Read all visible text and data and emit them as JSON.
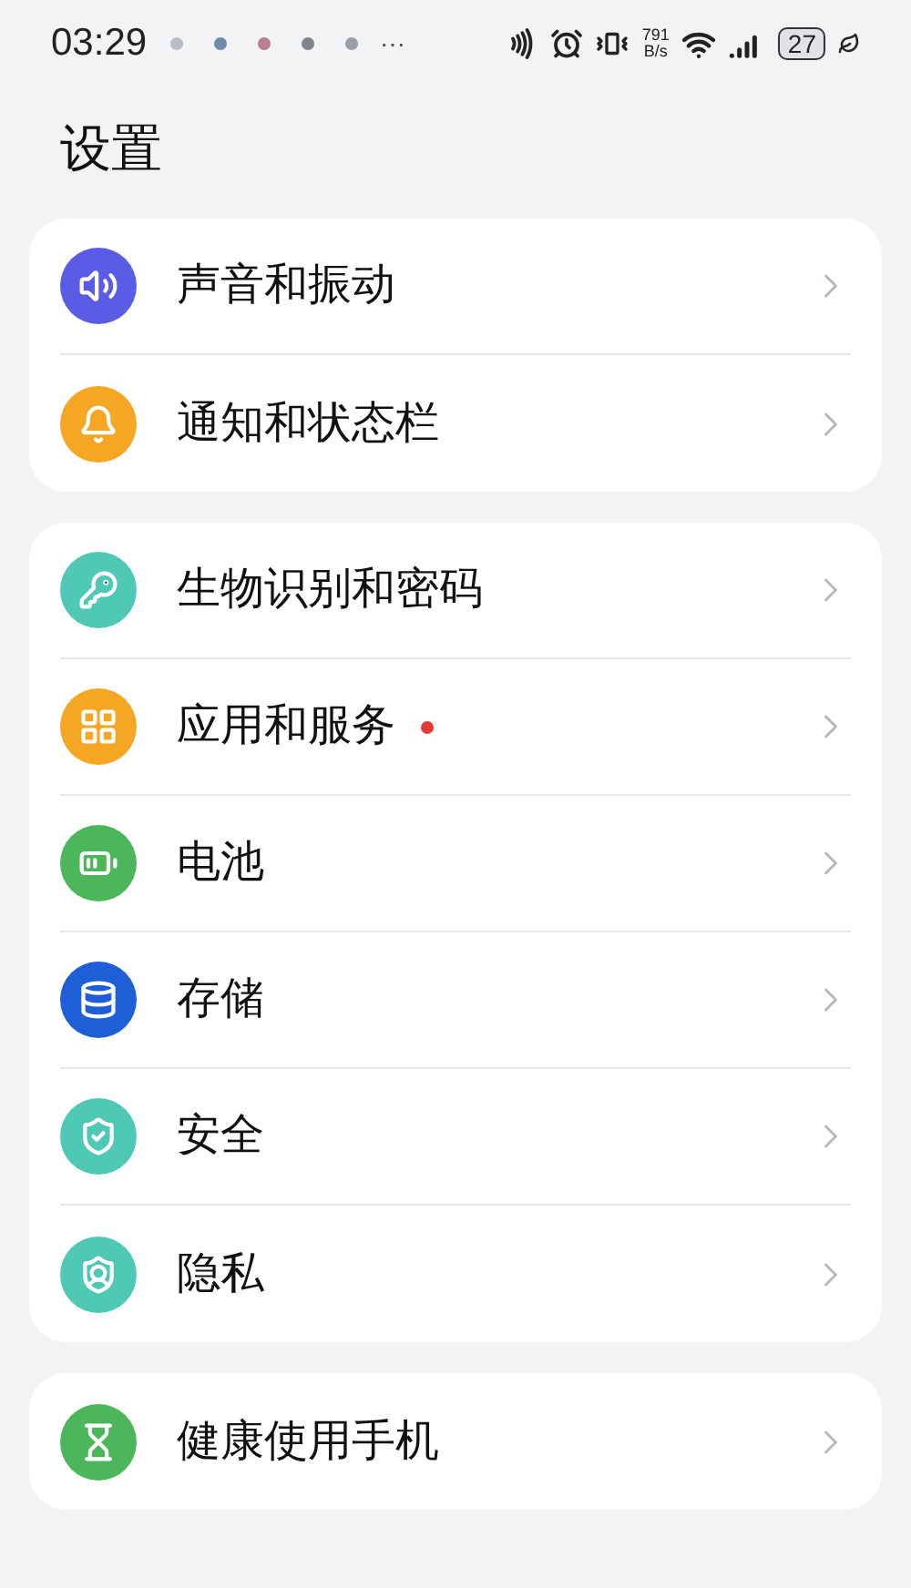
{
  "status_bar": {
    "time": "03:29",
    "more": "⋯",
    "speed_value": "791",
    "speed_unit": "B/s",
    "battery": "27"
  },
  "title": "设置",
  "groups": [
    {
      "items": [
        {
          "label": "声音和振动",
          "color": "#5b5ce6",
          "badge": false
        },
        {
          "label": "通知和状态栏",
          "color": "#f5a623",
          "badge": false
        }
      ]
    },
    {
      "items": [
        {
          "label": "生物识别和密码",
          "color": "#4fc9b5",
          "badge": false
        },
        {
          "label": "应用和服务",
          "color": "#f5a623",
          "badge": true
        },
        {
          "label": "电池",
          "color": "#4cb75a",
          "badge": false
        },
        {
          "label": "存储",
          "color": "#1e5fd8",
          "badge": false
        },
        {
          "label": "安全",
          "color": "#4fc9b5",
          "badge": false
        },
        {
          "label": "隐私",
          "color": "#4fc9b5",
          "badge": false
        }
      ]
    },
    {
      "items": [
        {
          "label": "健康使用手机",
          "color": "#4cb75a",
          "badge": false
        }
      ]
    }
  ]
}
